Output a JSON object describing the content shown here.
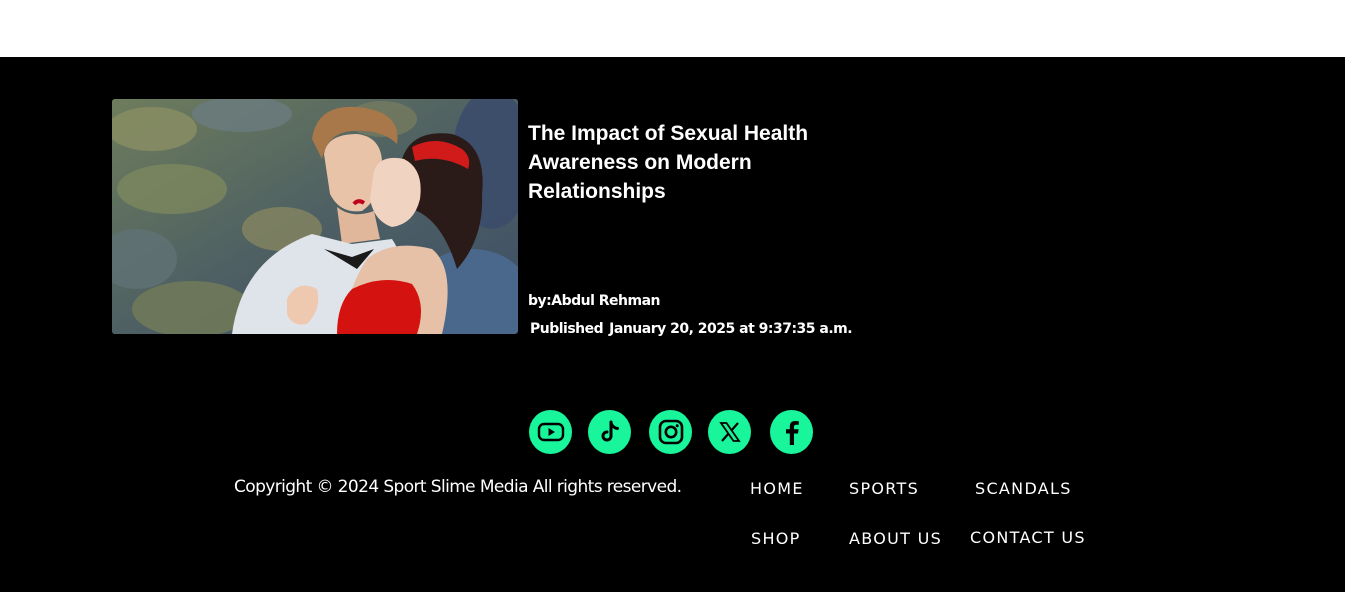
{
  "post": {
    "title": "The Impact of Sexual Health Awareness on Modern Relationships",
    "author": "by:Abdul Rehman",
    "published_label": "Published",
    "published_date": "January 20, 2025 at 9:37:35 a.m."
  },
  "social": {
    "accent_color": "#19f59a",
    "icons": [
      "youtube-icon",
      "tiktok-icon",
      "instagram-icon",
      "x-icon",
      "facebook-icon"
    ]
  },
  "footer": {
    "copyright": "Copyright © 2024 Sport Slime Media All rights reserved.",
    "nav": {
      "home": "HOME",
      "sports": "SPORTS",
      "scandals": "SCANDALS",
      "shop": "SHOP",
      "about": "ABOUT US",
      "contact": "CONTACT US"
    }
  }
}
